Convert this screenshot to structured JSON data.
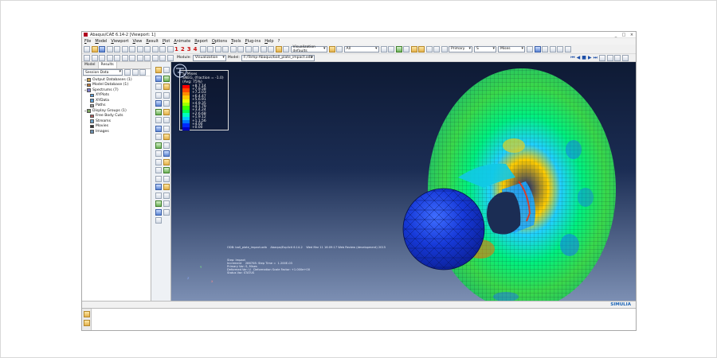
{
  "window": {
    "title": "Abaqus/CAE 6.14-2 [Viewport: 1]",
    "controls": [
      "_",
      "□",
      "×"
    ]
  },
  "menu": [
    "File",
    "Model",
    "Viewport",
    "View",
    "Result",
    "Plot",
    "Animate",
    "Report",
    "Options",
    "Tools",
    "Plug-ins",
    "Help",
    "?"
  ],
  "toolbar": {
    "numbers": [
      "1",
      "2",
      "3",
      "4"
    ],
    "visualization_defaults": "Visualization defaults",
    "all_filter": "All",
    "primary": "Primary",
    "s_var": "S",
    "mises": "Mises"
  },
  "context": {
    "module_label": "Module:",
    "module_value": "Visualization",
    "model_label": "Model:",
    "model_value": "F:/Temp-Abaqus/ball_plate_impact.odb"
  },
  "left_panel": {
    "tabs": [
      "Model",
      "Results"
    ],
    "active_tab": "Results",
    "session_label": "Session Data",
    "tree": [
      {
        "label": "Output Databases (1)",
        "expand": "+",
        "icon_color": "#c9a050",
        "indent": false
      },
      {
        "label": "Model Database (1)",
        "expand": "+",
        "icon_color": "#c07a3a",
        "indent": false
      },
      {
        "label": "Spectrums (7)",
        "expand": "+",
        "icon_color": "#7a7acb",
        "indent": false
      },
      {
        "label": "XYPlots",
        "expand": "",
        "icon_color": "#5a9bd4",
        "indent": true
      },
      {
        "label": "XYData",
        "expand": "",
        "icon_color": "#5a9bd4",
        "indent": true
      },
      {
        "label": "Paths",
        "expand": "",
        "icon_color": "#999999",
        "indent": true
      },
      {
        "label": "Display Groups (1)",
        "expand": "+",
        "icon_color": "#7da35e",
        "indent": false
      },
      {
        "label": "Free Body Cuts",
        "expand": "",
        "icon_color": "#b06060",
        "indent": true
      },
      {
        "label": "Streams",
        "expand": "",
        "icon_color": "#6aa0c8",
        "indent": true
      },
      {
        "label": "Movies",
        "expand": "",
        "icon_color": "#333333",
        "indent": true
      },
      {
        "label": "Images",
        "expand": "",
        "icon_color": "#6a8fb0",
        "indent": true
      }
    ]
  },
  "legend": {
    "title_lines": [
      "S, Mises",
      "SNEG, (fraction = -1.0)",
      "(Avg: 75%)"
    ],
    "values": [
      "+8.7.14",
      "+7.9.58",
      "+7.2.03",
      "+6.4.47",
      "+5.6.91",
      "+4.9.35",
      "+4.1.79",
      "+3.4.24",
      "+2.6.68",
      "+1.9.12",
      "+1.1.56",
      "+4.00",
      "+0.00"
    ],
    "colors": [
      "#ff0000",
      "#ff4a00",
      "#ff8c00",
      "#ffc800",
      "#e6ff00",
      "#a0ff00",
      "#3cff00",
      "#00ff50",
      "#00ffc0",
      "#00c8ff",
      "#0078ff",
      "#0028ff",
      "#0000c8"
    ]
  },
  "viewport_text": {
    "odb_line": "ODB: ball_plate_impact.odb    Abaqus/Explicit 6.14-2    Wed Mar 11 16:09:17 Web Review (development) 2015",
    "info_lines": [
      "Step: Impact",
      "Increment    286708: Step Time =  1.200E-03",
      "Primary Var: S, Mises",
      "Deformed Var: U   Deformation Scale Factor: +1.000e+00",
      "Status Var: STATUS"
    ],
    "triad_labels": [
      "Y",
      "Z",
      "X"
    ]
  },
  "branding": "SIMULIA",
  "colors": {
    "viewport_top": "#0e1a34",
    "viewport_bottom": "#7c8fb3",
    "accent_red": "#cc1111"
  }
}
